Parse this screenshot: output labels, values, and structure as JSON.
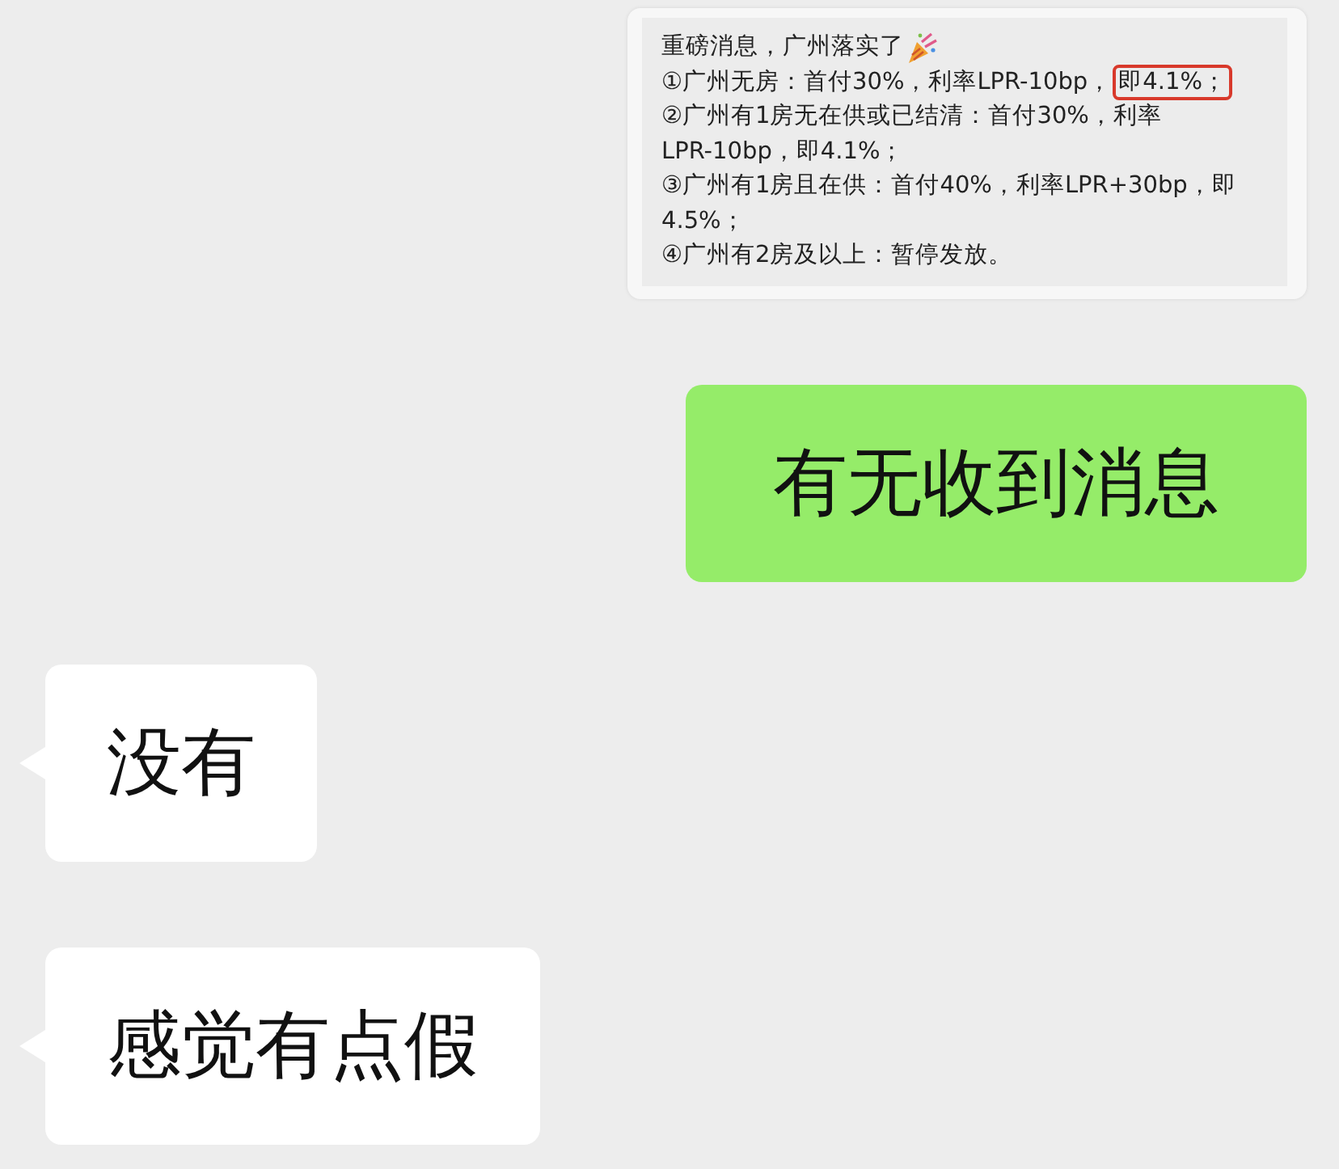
{
  "messages": [
    {
      "kind": "quote",
      "lines": [
        {
          "text": "重磅消息，广州落实了",
          "emoji": true
        },
        {
          "text": "①广州无房：首付30%，利率LPR-10bp，",
          "highlight": "即4.1%；"
        },
        {
          "text": "②广州有1房无在供或已结清：首付30%，利率"
        },
        {
          "text": "LPR-10bp，即4.1%；"
        },
        {
          "text": "③广州有1房且在供：首付40%，利率LPR+30bp，即"
        },
        {
          "text": "4.5%；"
        },
        {
          "text": "④广州有2房及以上：暂停发放。"
        }
      ]
    },
    {
      "kind": "sent",
      "text": "有无收到消息"
    },
    {
      "kind": "received",
      "text": "没有"
    },
    {
      "kind": "received",
      "text": "感觉有点假"
    }
  ]
}
